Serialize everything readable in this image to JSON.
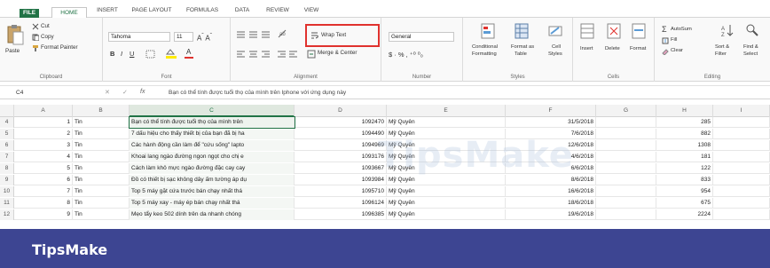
{
  "ribbon_tabs": [
    "FILE",
    "HOME",
    "INSERT",
    "PAGE LAYOUT",
    "FORMULAS",
    "DATA",
    "REVIEW",
    "VIEW"
  ],
  "clipboard": {
    "paste": "Paste",
    "cut": "Cut",
    "copy": "Copy",
    "format_painter": "Format Painter",
    "label": "Clipboard"
  },
  "font": {
    "name": "Tahoma",
    "size": "11",
    "label": "Font"
  },
  "alignment": {
    "wrap_text": "Wrap Text",
    "merge_center": "Merge & Center",
    "label": "Alignment"
  },
  "number": {
    "format": "General",
    "label": "Number"
  },
  "styles": {
    "conditional": "Conditional",
    "conditional2": "Formatting",
    "format_as": "Format as",
    "format_as2": "Table",
    "cell": "Cell",
    "cell2": "Styles",
    "label": "Styles"
  },
  "cells": {
    "insert": "Insert",
    "delete": "Delete",
    "format": "Format",
    "label": "Cells"
  },
  "editing": {
    "autosum": "AutoSum",
    "fill": "Fill",
    "clear": "Clear",
    "sort": "Sort &",
    "sort2": "Filter",
    "find": "Find &",
    "find2": "Select",
    "label": "Editing"
  },
  "formula_bar": {
    "name_box": "C4",
    "fx": "fx",
    "content": "Bạn có thể tính được tuổi thọ của mình trên Iphone với ứng dụng này"
  },
  "columns": [
    "A",
    "B",
    "C",
    "D",
    "E",
    "F",
    "G",
    "H",
    "I"
  ],
  "rows": [
    {
      "num": "4",
      "a": "1",
      "b": "Tin",
      "c": "Bạn có thể tính được tuổi thọ của mình trên",
      "d": "1092470",
      "e": "Mỹ Quyên",
      "f": "31/5/2018",
      "h": "285"
    },
    {
      "num": "5",
      "a": "2",
      "b": "Tin",
      "c": "7 dấu hiệu cho thấy thiết bị của bạn đã bị ha",
      "d": "1094490",
      "e": "Mỹ Quyên",
      "f": "7/6/2018",
      "h": "882"
    },
    {
      "num": "6",
      "a": "3",
      "b": "Tin",
      "c": "Các hành động cần làm để \"cứu sống\" lapto",
      "d": "1094969",
      "e": "Mỹ Quyên",
      "f": "12/6/2018",
      "h": "1308"
    },
    {
      "num": "7",
      "a": "4",
      "b": "Tin",
      "c": "Khoai lang ngào đường ngon ngọt cho chị e",
      "d": "1093176",
      "e": "Mỹ Quyên",
      "f": "4/6/2018",
      "h": "181"
    },
    {
      "num": "8",
      "a": "5",
      "b": "Tin",
      "c": "Cách làm khô mực ngào đường đặc cay cay",
      "d": "1093667",
      "e": "Mỹ Quyên",
      "f": "6/6/2018",
      "h": "122"
    },
    {
      "num": "9",
      "a": "6",
      "b": "Tin",
      "c": "Đồ có thiết bị sạc không dây ấm tường áp dụ",
      "d": "1093984",
      "e": "Mỹ Quyên",
      "f": "8/6/2018",
      "h": "833"
    },
    {
      "num": "10",
      "a": "7",
      "b": "Tin",
      "c": "Top 5 máy gặt cứa trước bán chạy nhất thá",
      "d": "1095710",
      "e": "Mỹ Quyên",
      "f": "16/6/2018",
      "h": "954"
    },
    {
      "num": "11",
      "a": "8",
      "b": "Tin",
      "c": "Top 5 máy xay - máy ép bán chạy nhất thá",
      "d": "1096124",
      "e": "Mỹ Quyên",
      "f": "18/6/2018",
      "h": "675"
    },
    {
      "num": "12",
      "a": "9",
      "b": "Tin",
      "c": "Mẹo tẩy keo 502 dính trên da nhanh chóng",
      "d": "1096385",
      "e": "Mỹ Quyên",
      "f": "19/6/2018",
      "h": "2224"
    }
  ],
  "watermark": "TipsMake",
  "banner": "TipsMake",
  "colors": {
    "excel_green": "#217346",
    "banner": "#3d4592",
    "highlight": "#e0322e"
  }
}
